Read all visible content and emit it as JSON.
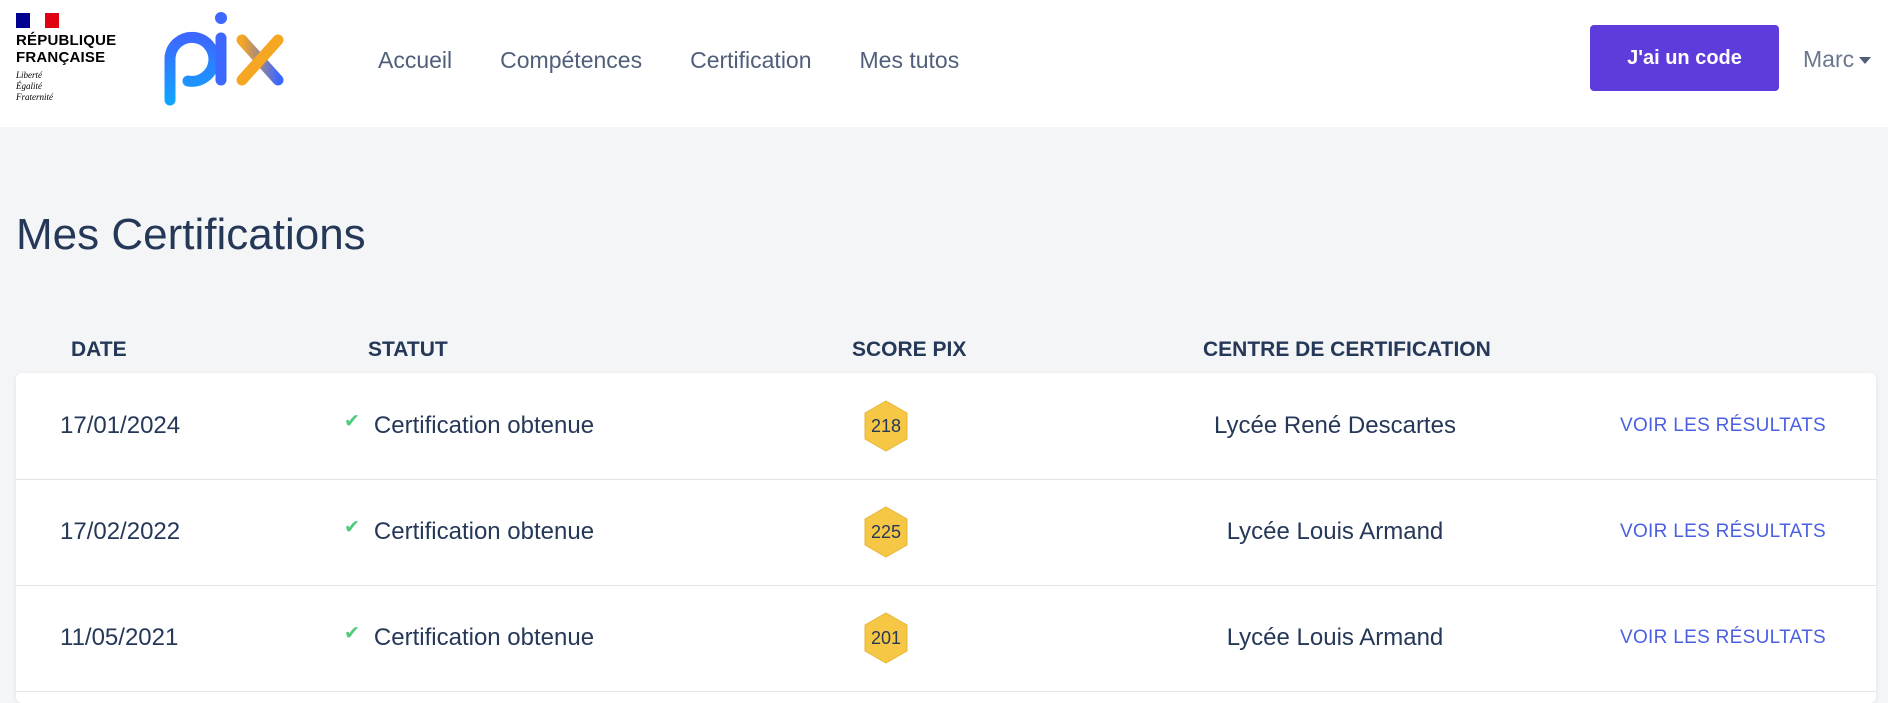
{
  "header": {
    "rf": {
      "line1": "RÉPUBLIQUE",
      "line2": "FRANÇAISE",
      "motto1": "Liberté",
      "motto2": "Égalité",
      "motto3": "Fraternité"
    },
    "nav": [
      "Accueil",
      "Compétences",
      "Certification",
      "Mes tutos"
    ],
    "code_button": "J'ai un code",
    "user_name": "Marc"
  },
  "icons": {
    "logo": "pix-logo",
    "flag": "french-flag",
    "check": "check-icon",
    "caret": "chevron-down-icon",
    "badge": "hexagon-badge"
  },
  "colors": {
    "primary": "#5e3bdb",
    "link": "#4b5fe3",
    "badge": "#f6c744",
    "check": "#4fcb7b",
    "text": "#253858"
  },
  "page": {
    "title": "Mes Certifications"
  },
  "table": {
    "headers": [
      "DATE",
      "STATUT",
      "SCORE PIX",
      "CENTRE DE CERTIFICATION"
    ],
    "rows": [
      {
        "date": "17/01/2024",
        "status": "Certification obtenue",
        "score": "218",
        "center": "Lycée René Descartes",
        "action": "VOIR LES RÉSULTATS"
      },
      {
        "date": "17/02/2022",
        "status": "Certification obtenue",
        "score": "225",
        "center": "Lycée Louis Armand",
        "action": "VOIR LES RÉSULTATS"
      },
      {
        "date": "11/05/2021",
        "status": "Certification obtenue",
        "score": "201",
        "center": "Lycée Louis Armand",
        "action": "VOIR LES RÉSULTATS"
      }
    ]
  }
}
